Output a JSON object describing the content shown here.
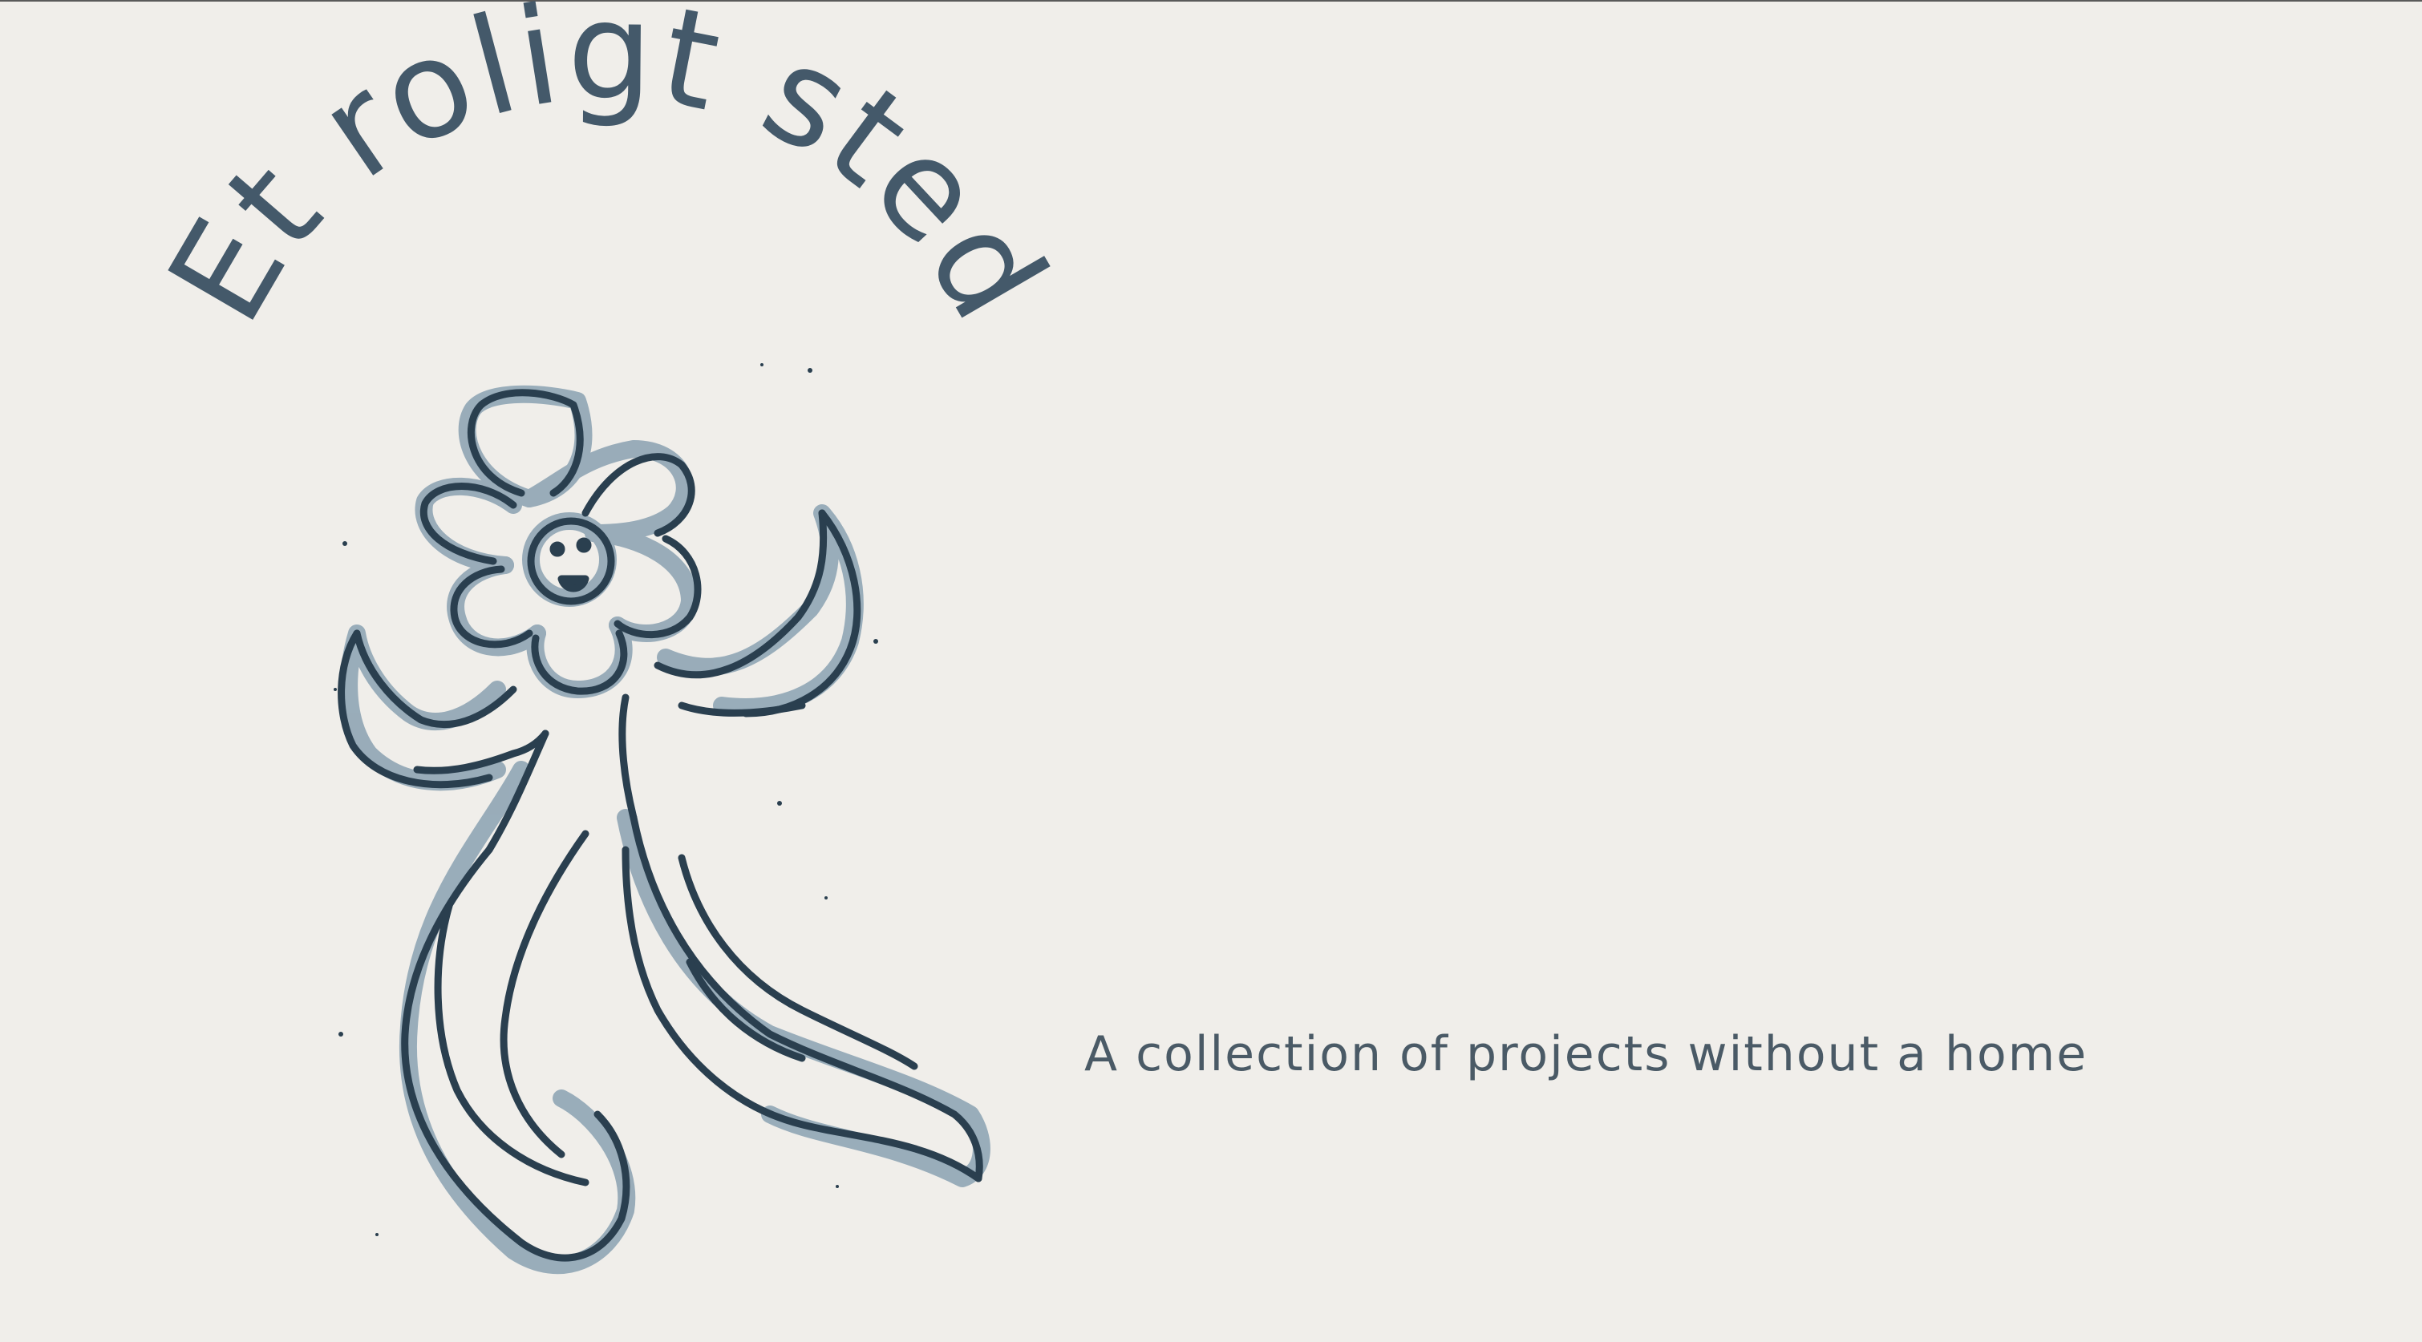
{
  "site": {
    "title": "Et roligt sted",
    "tagline": "A collection of projects without a home"
  },
  "colors": {
    "background": "#f0eeea",
    "title_ink": "#44596a",
    "drawing_stroke": "#2a3f4f",
    "drawing_fill": "#8aa1b1",
    "tagline_ink": "#4a5a66"
  },
  "illustration": {
    "icon": "dancing-flower-figure-icon"
  }
}
